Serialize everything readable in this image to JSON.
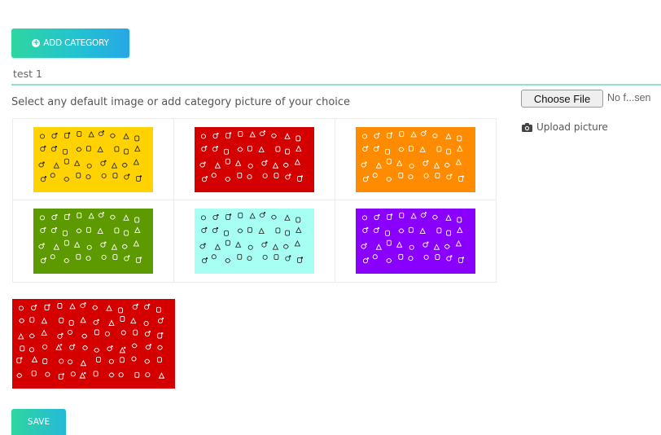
{
  "form": {
    "add_category_label": "ADD CATEGORY",
    "category_name_value": "test 1",
    "instruction_text": "Select any default image or add category picture of your choice",
    "save_label": "SAVE"
  },
  "upload": {
    "choose_file_label": "Choose File",
    "file_status": "No f...sen",
    "upload_picture_label": "Upload picture"
  },
  "default_images": [
    {
      "name": "yellow",
      "color": "#ffd200"
    },
    {
      "name": "red",
      "color": "#d40000"
    },
    {
      "name": "orange",
      "color": "#ff8c00"
    },
    {
      "name": "green",
      "color": "#5c9a00"
    },
    {
      "name": "aqua",
      "color": "#a6fff2"
    },
    {
      "name": "purple",
      "color": "#8a00ff"
    }
  ],
  "selected_preview": {
    "color": "#d40000"
  },
  "icons": {
    "add": "plus-circle-icon",
    "camera": "camera-icon",
    "pattern": "doodle-icons-pattern"
  },
  "colors": {
    "accent_green": "#2fd6a0",
    "accent_blue": "#27a7e6",
    "underline": "#8fe0c4"
  }
}
